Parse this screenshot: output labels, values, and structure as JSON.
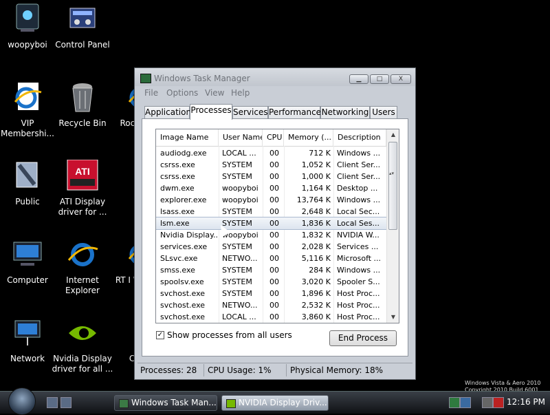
{
  "desktop": {
    "icons": [
      {
        "label": "woopyboi"
      },
      {
        "label": "Control Panel"
      },
      {
        "label": "VIP Membershi..."
      },
      {
        "label": "Recycle Bin"
      },
      {
        "label": "Rocke..."
      },
      {
        "label": "Public"
      },
      {
        "label": "ATI Display driver for ..."
      },
      {
        "label": "Computer"
      },
      {
        "label": "Internet Explorer"
      },
      {
        "label": "RT I World"
      },
      {
        "label": "Network"
      },
      {
        "label": "Nvidia Display driver for all ..."
      },
      {
        "label": "CCI"
      }
    ],
    "watermark_line1": "Windows Vista & Aero 2010",
    "watermark_line2": "Copyright 2010 Build 6001"
  },
  "window": {
    "title": "Windows Task Manager",
    "min_label": "▁",
    "max_label": "□",
    "close_label": "X",
    "menu": [
      "File",
      "Options",
      "View",
      "Help"
    ],
    "tabs": [
      "Applications",
      "Processes",
      "Services",
      "Performance",
      "Networking",
      "Users"
    ],
    "active_tab": 1,
    "columns": [
      "Image Name",
      "User Name",
      "CPU",
      "Memory (...",
      "Description"
    ],
    "rows": [
      {
        "name": "audiodg.exe",
        "user": "LOCAL ...",
        "cpu": "00",
        "mem": "712 K",
        "desc": "Windows ..."
      },
      {
        "name": "csrss.exe",
        "user": "SYSTEM",
        "cpu": "00",
        "mem": "1,052 K",
        "desc": "Client Ser..."
      },
      {
        "name": "csrss.exe",
        "user": "SYSTEM",
        "cpu": "00",
        "mem": "1,000 K",
        "desc": "Client Ser..."
      },
      {
        "name": "dwm.exe",
        "user": "woopyboi",
        "cpu": "00",
        "mem": "1,164 K",
        "desc": "Desktop ..."
      },
      {
        "name": "explorer.exe",
        "user": "woopyboi",
        "cpu": "00",
        "mem": "13,764 K",
        "desc": "Windows ..."
      },
      {
        "name": "lsass.exe",
        "user": "SYSTEM",
        "cpu": "00",
        "mem": "2,648 K",
        "desc": "Local Sec..."
      },
      {
        "name": "lsm.exe",
        "user": "SYSTEM",
        "cpu": "00",
        "mem": "1,836 K",
        "desc": "Local Ses..."
      },
      {
        "name": "Nvidia Display...",
        "user": "woopyboi",
        "cpu": "00",
        "mem": "1,832 K",
        "desc": "NVIDIA W..."
      },
      {
        "name": "services.exe",
        "user": "SYSTEM",
        "cpu": "00",
        "mem": "2,028 K",
        "desc": "Services ..."
      },
      {
        "name": "SLsvc.exe",
        "user": "NETWO...",
        "cpu": "00",
        "mem": "5,116 K",
        "desc": "Microsoft ..."
      },
      {
        "name": "smss.exe",
        "user": "SYSTEM",
        "cpu": "00",
        "mem": "284 K",
        "desc": "Windows ..."
      },
      {
        "name": "spoolsv.exe",
        "user": "SYSTEM",
        "cpu": "00",
        "mem": "3,020 K",
        "desc": "Spooler S..."
      },
      {
        "name": "svchost.exe",
        "user": "SYSTEM",
        "cpu": "00",
        "mem": "1,896 K",
        "desc": "Host Proc..."
      },
      {
        "name": "svchost.exe",
        "user": "NETWO...",
        "cpu": "00",
        "mem": "2,532 K",
        "desc": "Host Proc..."
      },
      {
        "name": "svchost.exe",
        "user": "LOCAL ...",
        "cpu": "00",
        "mem": "3,860 K",
        "desc": "Host Proc..."
      }
    ],
    "show_all_label": "Show processes from all users",
    "show_all_checked": "✓",
    "end_process_label": "End Process",
    "status": {
      "processes": "Processes: 28",
      "cpu": "CPU Usage: 1%",
      "memory": "Physical Memory: 18%"
    }
  },
  "taskbar": {
    "buttons": [
      "Windows Task Man...",
      "NVIDIA Display Driv..."
    ],
    "clock": "12:16 PM"
  }
}
